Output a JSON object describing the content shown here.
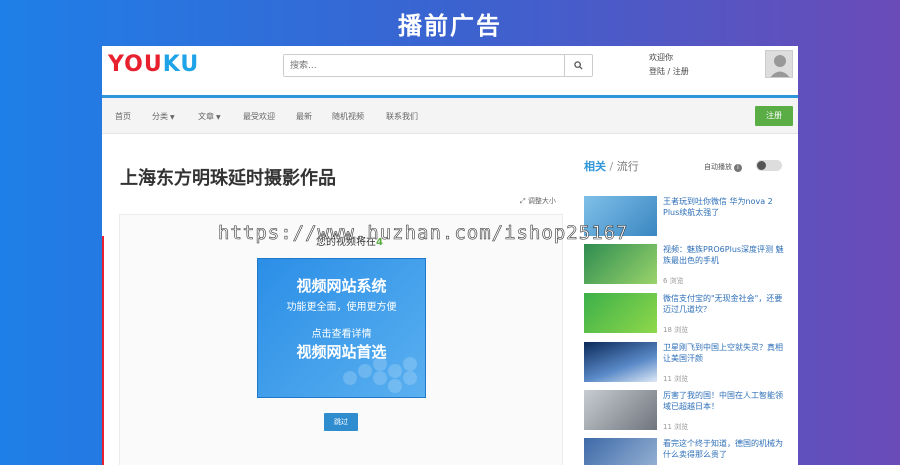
{
  "banner": {
    "title": "播前广告"
  },
  "header": {
    "logo": [
      "Y",
      "O",
      "U",
      "K",
      "U"
    ],
    "search_placeholder": "搜索...",
    "search_icon": "search-icon",
    "welcome": "欢迎你",
    "login_register": "登陆 / 注册",
    "avatar_icon": "user-icon"
  },
  "nav": {
    "items": [
      "首页",
      "分类",
      "文章",
      "最受欢迎",
      "最新",
      "随机视频",
      "联系我们"
    ],
    "register_label": "注册"
  },
  "page": {
    "title": "上海东方明珠延时摄影作品",
    "resize_label": "调整大小"
  },
  "player": {
    "countdown_prefix": "您的视频将在",
    "countdown_value": "4",
    "ad": {
      "line1": "视频网站系统",
      "line2": "功能更全面，使用更方便",
      "line3": "点击查看详情",
      "line4": "视频网站首选"
    },
    "skip_label": "跳过"
  },
  "sidebar": {
    "tab_related": "相关",
    "tab_separator": "/",
    "tab_popular": "流行",
    "autoplay_label": "自动播放",
    "videos": [
      {
        "title": "王者玩到吐你微信 华为nova 2 Plus续航太强了",
        "views": ""
      },
      {
        "title": "视频：魅族PRO6Plus深度评测 魅族最出色的手机",
        "views": "6 浏览"
      },
      {
        "title": "微信支付宝的\"无现金社会\"，还要迈过几道坎？",
        "views": "18 浏览"
      },
      {
        "title": "卫星刚飞到中国上空就失灵？真相让美国汗颜",
        "views": "11 浏览"
      },
      {
        "title": "厉害了我的国！中国在人工智能领域已超越日本！",
        "views": "11 浏览"
      },
      {
        "title": "看完这个终于知道，德国的机械为什么卖得那么贵了",
        "views": ""
      }
    ]
  },
  "watermark": "https://www.huzhan.com/ishop25167",
  "colors": {
    "accent": "#2e96d9",
    "register": "#5aac45",
    "logo_red": "#e8212f",
    "logo_blue": "#1fa3e8"
  }
}
